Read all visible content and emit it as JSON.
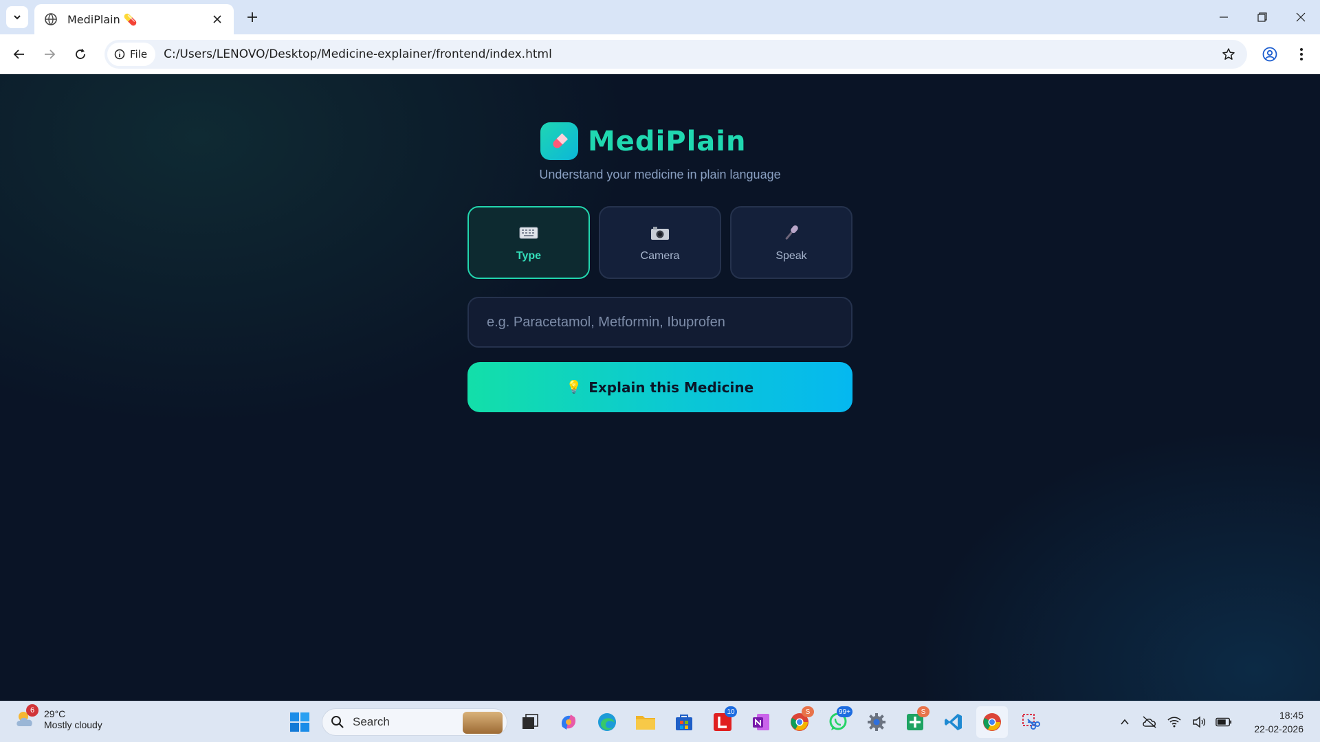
{
  "browser": {
    "tab_title": "MediPlain 💊",
    "site_chip": "File",
    "url": "C:/Users/LENOVO/Desktop/Medicine-explainer/frontend/index.html"
  },
  "page": {
    "brand_name": "MediPlain",
    "tagline": "Understand your medicine in plain language",
    "modes": [
      {
        "label": "Type",
        "icon": "keyboard-icon",
        "active": true
      },
      {
        "label": "Camera",
        "icon": "camera-icon",
        "active": false
      },
      {
        "label": "Speak",
        "icon": "microphone-icon",
        "active": false
      }
    ],
    "input_placeholder": "e.g. Paracetamol, Metformin, Ibuprofen",
    "input_value": "",
    "explain_button": "Explain this Medicine",
    "explain_icon": "💡"
  },
  "taskbar": {
    "weather_badge": "6",
    "weather_temp": "29°C",
    "weather_condition": "Mostly cloudy",
    "search_label": "Search",
    "badges": {
      "lens": "10",
      "chrome_profile": "S",
      "whatsapp": "99+",
      "sheets_profile": "S"
    },
    "clock_time": "18:45",
    "clock_date": "22-02-2026"
  },
  "colors": {
    "accent": "#20d8b0",
    "background": "#0a1426",
    "button_gradient_start": "#13dfa9",
    "button_gradient_end": "#05b8f0"
  }
}
